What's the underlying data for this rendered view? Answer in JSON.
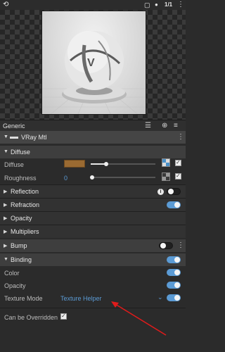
{
  "topbar": {
    "zoom_label": "1/1"
  },
  "generic": {
    "title": "Generic"
  },
  "material": {
    "name": "VRay Mtl"
  },
  "diffuse": {
    "title": "Diffuse",
    "color_label": "Diffuse",
    "color_value": "#9a6a32",
    "roughness_label": "Roughness",
    "roughness_value": "0"
  },
  "sections": {
    "reflection": "Reflection",
    "refraction": "Refraction",
    "opacity": "Opacity",
    "multipliers": "Multipliers",
    "bump": "Bump",
    "binding": "Binding"
  },
  "binding": {
    "color_label": "Color",
    "opacity_label": "Opacity",
    "texture_mode_label": "Texture Mode",
    "texture_mode_value": "Texture Helper"
  },
  "overridden": {
    "label": "Can be Overridden"
  },
  "colors": {
    "accent": "#5b9bd5",
    "annotation_arrow": "#e01b1b"
  }
}
